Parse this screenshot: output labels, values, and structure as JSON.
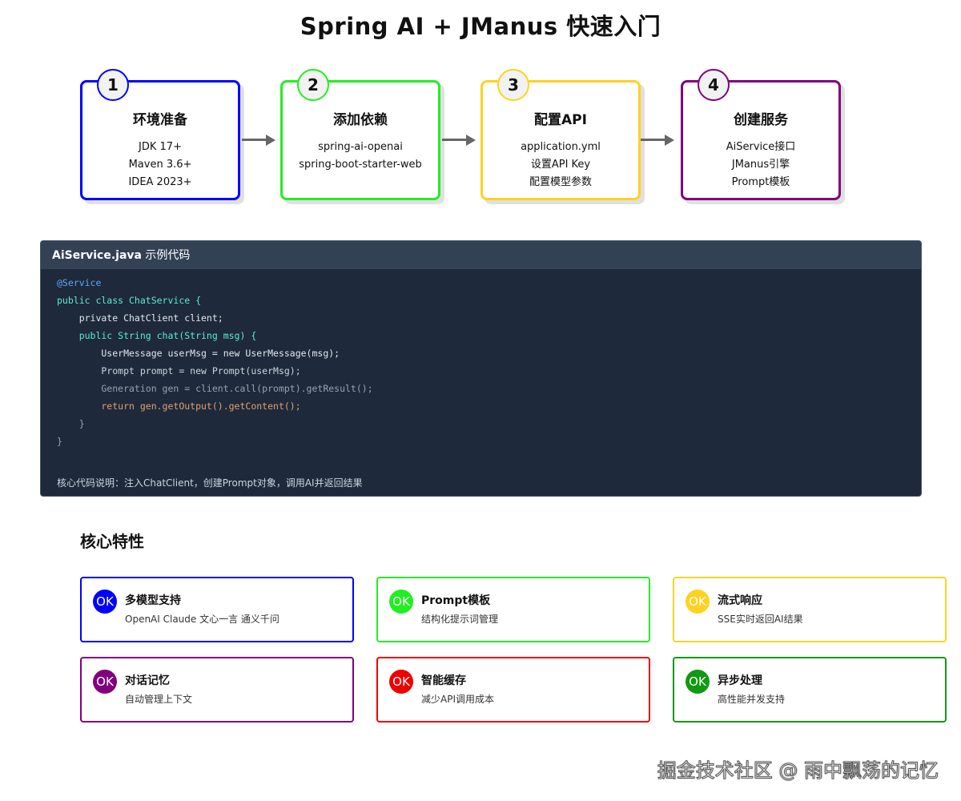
{
  "title": "Spring AI + JManus 快速入门",
  "steps": [
    {
      "number": "1",
      "title": "环境准备",
      "lines": [
        "JDK 17+",
        "Maven 3.6+",
        "IDEA 2023+"
      ],
      "color": "#0000ff"
    },
    {
      "number": "2",
      "title": "添加依赖",
      "lines": [
        "spring-ai-openai",
        "spring-boot-starter-web"
      ],
      "color": "#22ee22"
    },
    {
      "number": "3",
      "title": "配置API",
      "lines": [
        "application.yml",
        "设置API Key",
        "配置模型参数"
      ],
      "color": "#ffd21f"
    },
    {
      "number": "4",
      "title": "创建服务",
      "lines": [
        "AiService接口",
        "JManus引擎",
        "Prompt模板"
      ],
      "color": "#800080"
    }
  ],
  "code": {
    "filename": "AiService.java",
    "filename_suffix": " 示例代码",
    "lines": [
      "@Service",
      "public class ChatService {",
      "    private ChatClient client;",
      "    public String chat(String msg) {",
      "        UserMessage userMsg = new UserMessage(msg);",
      "        Prompt prompt = new Prompt(userMsg);",
      "        Generation gen = client.call(prompt).getResult();",
      "        return gen.getOutput().getContent();",
      "    }",
      "}"
    ],
    "note": "核心代码说明：注入ChatClient，创建Prompt对象，调用AI并返回结果"
  },
  "features_title": "核心特性",
  "features": [
    {
      "icon": "OK",
      "title": "多模型支持",
      "desc": "OpenAI Claude 文心一言 通义千问",
      "color": "#0000ff"
    },
    {
      "icon": "OK",
      "title": "Prompt模板",
      "desc": "结构化提示词管理",
      "color": "#22ee22"
    },
    {
      "icon": "OK",
      "title": "流式响应",
      "desc": "SSE实时返回AI结果",
      "color": "#ffd21f"
    },
    {
      "icon": "OK",
      "title": "对话记忆",
      "desc": "自动管理上下文",
      "color": "#800080"
    },
    {
      "icon": "OK",
      "title": "智能缓存",
      "desc": "减少API调用成本",
      "color": "#ee0000"
    },
    {
      "icon": "OK",
      "title": "异步处理",
      "desc": "高性能并发支持",
      "color": "#119911"
    }
  ],
  "watermark": "掘金技术社区 @ 雨中飘荡的记忆"
}
